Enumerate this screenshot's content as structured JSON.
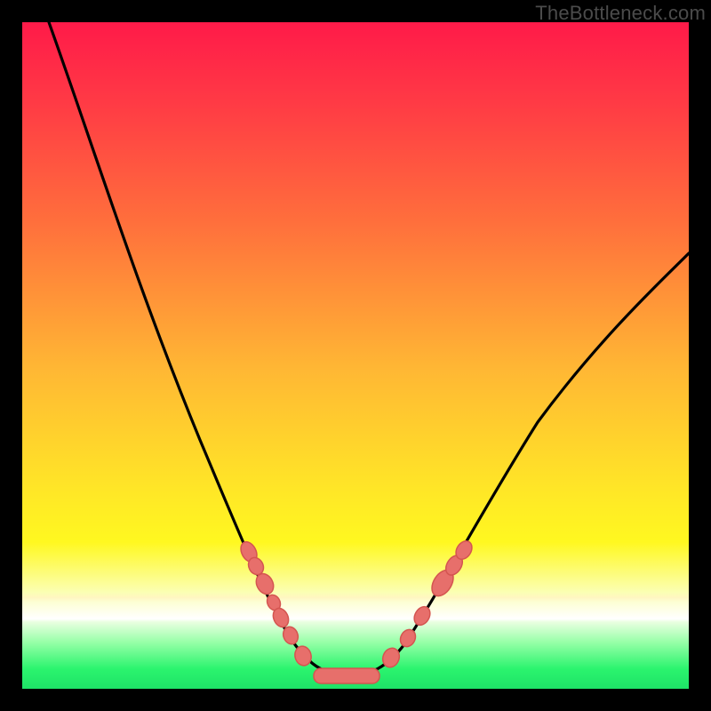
{
  "watermark": "TheBottleneck.com",
  "colors": {
    "frame": "#000000",
    "gradient_top": "#ff1a49",
    "gradient_mid": "#ffe627",
    "gradient_bottom": "#1ee267",
    "curve": "#000000",
    "markers": "#e76f6b"
  },
  "chart_data": {
    "type": "line",
    "title": "",
    "xlabel": "",
    "ylabel": "",
    "xlim": [
      0,
      100
    ],
    "ylim": [
      0,
      100
    ],
    "series": [
      {
        "name": "bottleneck-curve",
        "x": [
          4,
          10,
          15,
          20,
          25,
          30,
          34,
          36,
          38,
          40,
          42,
          44,
          46,
          50,
          55,
          60,
          65,
          70,
          75,
          80,
          85,
          90,
          95,
          100
        ],
        "y": [
          100,
          82,
          68,
          54,
          42,
          31,
          21,
          17,
          12,
          8,
          5,
          3,
          2,
          2,
          4,
          9,
          15,
          22,
          28,
          35,
          41,
          46,
          51,
          55
        ]
      }
    ],
    "markers": [
      {
        "series": "bottleneck-curve",
        "x": 34,
        "y": 21
      },
      {
        "series": "bottleneck-curve",
        "x": 35,
        "y": 19
      },
      {
        "series": "bottleneck-curve",
        "x": 36,
        "y": 16
      },
      {
        "series": "bottleneck-curve",
        "x": 37,
        "y": 13
      },
      {
        "series": "bottleneck-curve",
        "x": 38,
        "y": 11
      },
      {
        "series": "bottleneck-curve",
        "x": 39,
        "y": 9
      },
      {
        "series": "bottleneck-curve",
        "x": 41,
        "y": 6
      },
      {
        "series": "bottleneck-curve",
        "x": 43,
        "y": 3
      },
      {
        "series": "bottleneck-curve",
        "x": 45,
        "y": 2
      },
      {
        "series": "bottleneck-curve",
        "x": 46,
        "y": 2
      },
      {
        "series": "bottleneck-curve",
        "x": 47,
        "y": 2
      },
      {
        "series": "bottleneck-curve",
        "x": 48,
        "y": 2
      },
      {
        "series": "bottleneck-curve",
        "x": 49,
        "y": 2
      },
      {
        "series": "bottleneck-curve",
        "x": 50,
        "y": 2
      },
      {
        "series": "bottleneck-curve",
        "x": 51,
        "y": 2
      },
      {
        "series": "bottleneck-curve",
        "x": 52,
        "y": 2
      },
      {
        "series": "bottleneck-curve",
        "x": 53,
        "y": 3
      },
      {
        "series": "bottleneck-curve",
        "x": 56,
        "y": 5
      },
      {
        "series": "bottleneck-curve",
        "x": 59,
        "y": 8
      },
      {
        "series": "bottleneck-curve",
        "x": 62,
        "y": 12
      },
      {
        "series": "bottleneck-curve",
        "x": 63,
        "y": 13
      },
      {
        "series": "bottleneck-curve",
        "x": 64,
        "y": 15
      },
      {
        "series": "bottleneck-curve",
        "x": 65,
        "y": 16
      },
      {
        "series": "bottleneck-curve",
        "x": 66,
        "y": 18
      },
      {
        "series": "bottleneck-curve",
        "x": 67,
        "y": 19
      },
      {
        "series": "bottleneck-curve",
        "x": 68,
        "y": 20
      }
    ]
  }
}
